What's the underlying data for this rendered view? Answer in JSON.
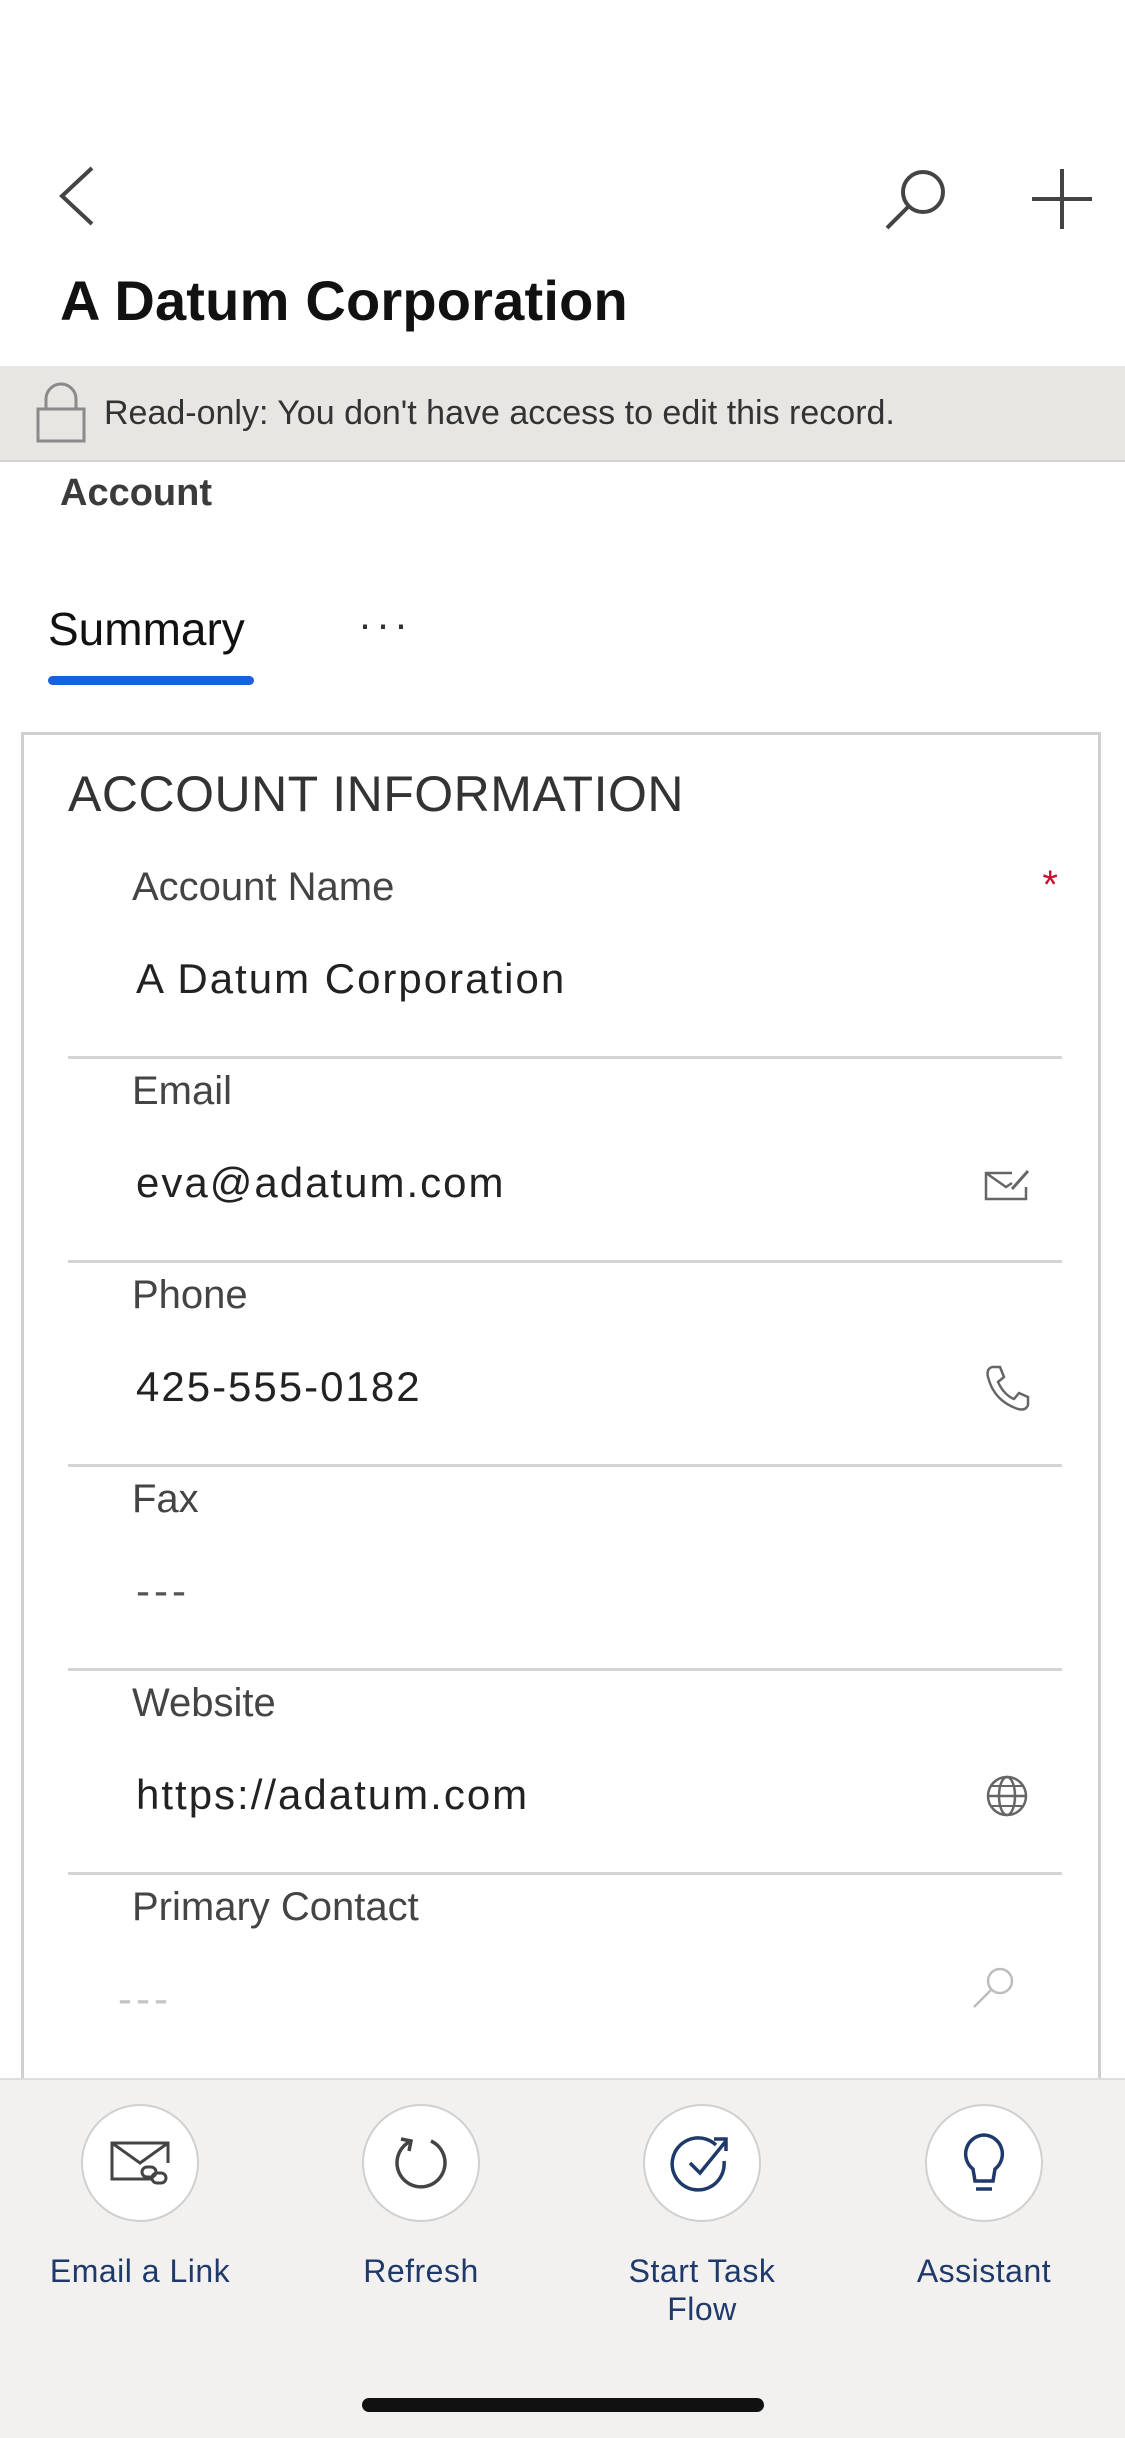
{
  "header": {
    "title": "A Datum Corporation"
  },
  "banner": {
    "message": "Read-only: You don't have access to edit this record."
  },
  "entity_type": "Account",
  "tabs": {
    "active": "Summary",
    "more": "···"
  },
  "section": {
    "title": "ACCOUNT INFORMATION",
    "required_marker": "*",
    "fields": [
      {
        "label": "Account Name",
        "value": "A Datum Corporation"
      },
      {
        "label": "Email",
        "value": "eva@adatum.com",
        "icon": "email-compose-icon"
      },
      {
        "label": "Phone",
        "value": "425-555-0182",
        "icon": "phone-icon"
      },
      {
        "label": "Fax",
        "value": "---"
      },
      {
        "label": "Website",
        "value": "https://adatum.com",
        "icon": "globe-icon"
      },
      {
        "label": "Primary Contact",
        "value": "---",
        "icon": "lookup-search-icon"
      }
    ]
  },
  "actions": [
    {
      "label": "Email a Link",
      "icon": "email-link-icon"
    },
    {
      "label": "Refresh",
      "icon": "refresh-icon"
    },
    {
      "label": "Start Task Flow",
      "icon": "task-flow-icon"
    },
    {
      "label": "Assistant",
      "icon": "lightbulb-icon"
    }
  ],
  "colors": {
    "accent": "#1a5fe0",
    "required": "#c8102e",
    "banner_bg": "#e8e6e3",
    "action_text": "#1f3a6a"
  }
}
